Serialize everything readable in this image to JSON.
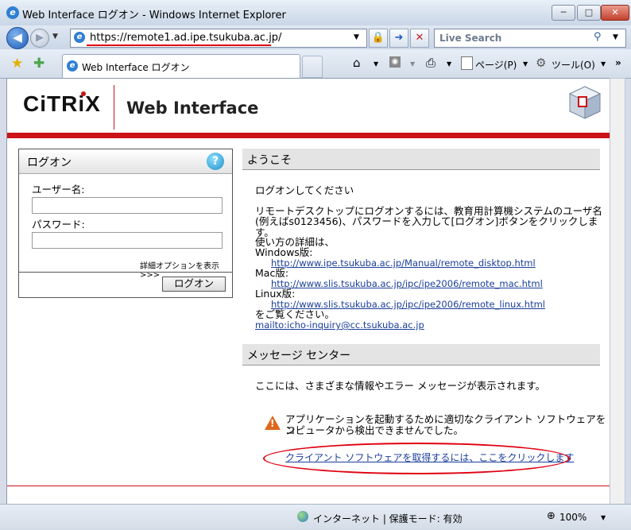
{
  "window": {
    "title": "Web Interface ログオン - Windows Internet Explorer",
    "minimize": "─",
    "maximize": "□",
    "close": "✕"
  },
  "navigation": {
    "back": "◀",
    "forward": "▶",
    "address": "https://remote1.ad.ipe.tsukuba.ac.jp/",
    "search_placeholder": "Live Search"
  },
  "tabs": [
    {
      "label": "Web Interface ログオン",
      "active": true
    }
  ],
  "command_bar": {
    "page": "ページ(P)",
    "tools": "ツール(O)"
  },
  "header": {
    "logo_text": "CiTRiX",
    "product_title": "Web Interface"
  },
  "login": {
    "title": "ログオン",
    "username_label": "ユーザー名:",
    "username_value": "",
    "password_label": "パスワード:",
    "password_value": "",
    "advanced_options": "詳細オプションを表示 >>>",
    "login_button": "ログオン"
  },
  "welcome": {
    "title": "ようこそ",
    "line1": "ログオンしてください",
    "line2": "リモートデスクトップにログオンするには、教育用計算機システムのユーザ名",
    "line3": "(例えばs0123456)、パスワードを入力して[ログオン]ボタンをクリックします。",
    "usage_intro": "使い方の詳細は、",
    "windows_label": "Windows版:",
    "windows_url": "http://www.ipe.tsukuba.ac.jp/Manual/remote_disktop.html",
    "mac_label": "Mac版:",
    "mac_url": "http://www.slis.tsukuba.ac.jp/ipc/ipe2006/remote_mac.html",
    "linux_label": "Linux版:",
    "linux_url": "http://www.slis.tsukuba.ac.jp/ipc/ipe2006/remote_linux.html",
    "closing": "をご覧ください。",
    "mailto": "mailto:icho-inquiry@cc.tsukuba.ac.jp"
  },
  "message_center": {
    "title": "メッセージ センター",
    "info": "ここには、さまざまな情報やエラー メッセージが表示されます。",
    "warning_line1": "アプリケーションを起動するために適切なクライアント ソフトウェアをコ",
    "warning_line2": "ンピュータから検出できませんでした。",
    "client_link": "クライアント ソフトウェアを取得するには、ここをクリックします"
  },
  "status": {
    "zone": "インターネット | 保護モード: 有効",
    "zoom": "100%"
  }
}
